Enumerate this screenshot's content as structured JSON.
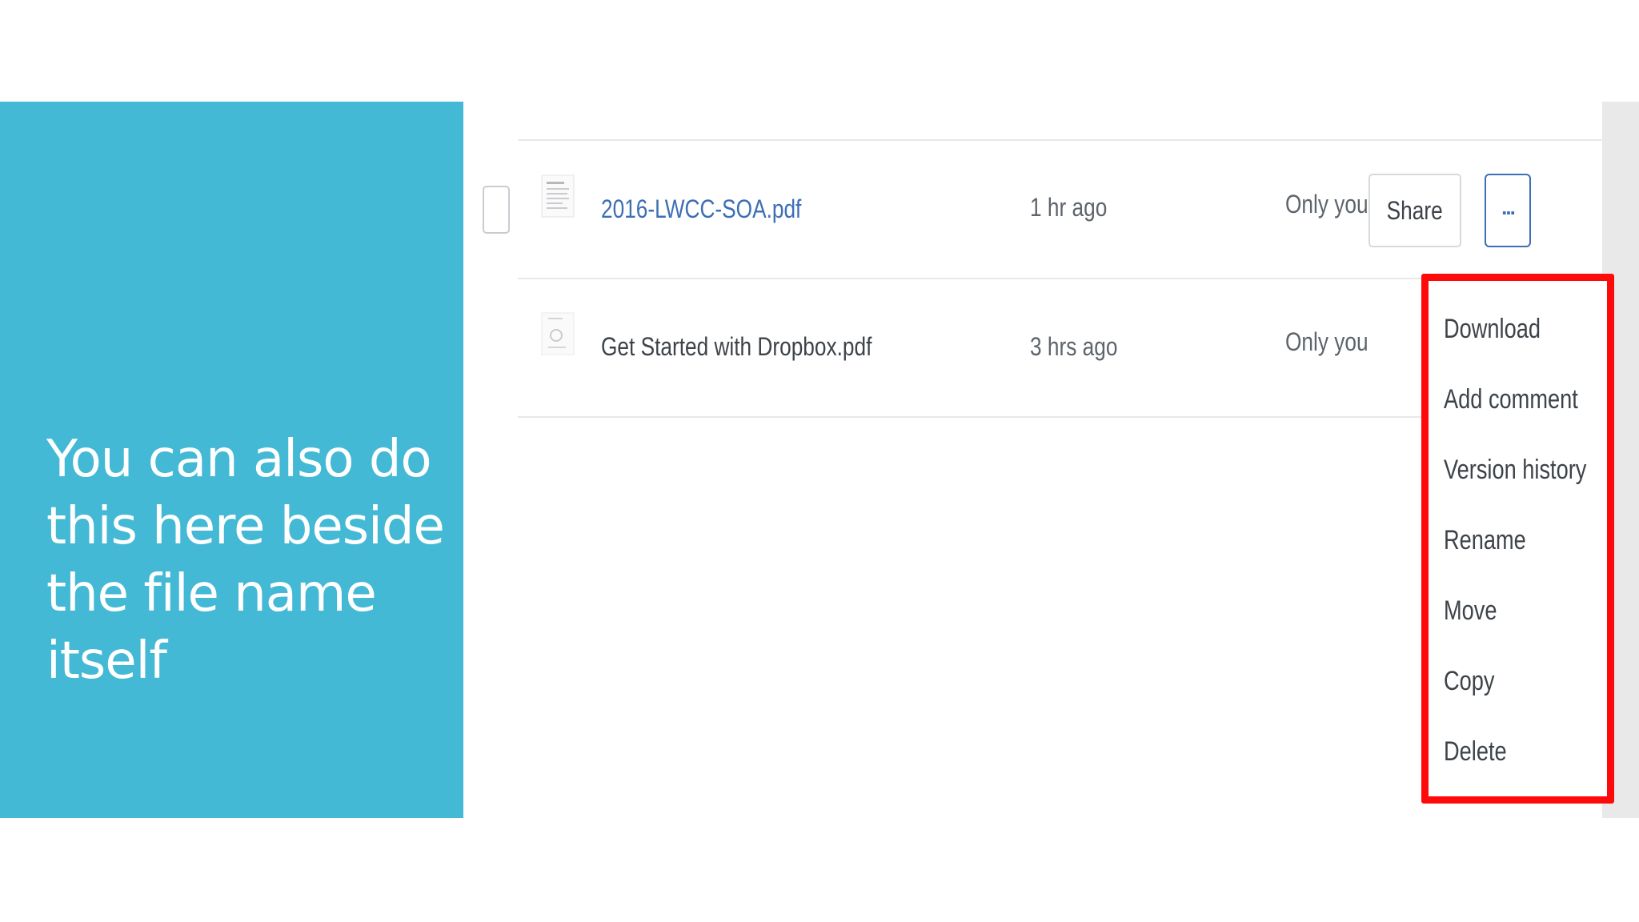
{
  "slide": {
    "text": "You can also do this here beside the file name itself"
  },
  "files": [
    {
      "name": "2016-LWCC-SOA.pdf",
      "modified": "1 hr ago",
      "members": "Only you",
      "selected_style": "link"
    },
    {
      "name": "Get Started with Dropbox.pdf",
      "modified": "3 hrs ago",
      "members": "Only you",
      "selected_style": "plain"
    }
  ],
  "actions": {
    "share_label": "Share",
    "more_label": "..."
  },
  "menu": {
    "items": [
      "Download",
      "Add comment",
      "Version history",
      "Rename",
      "Move",
      "Copy",
      "Delete"
    ]
  },
  "colors": {
    "panel": "#43b9d5",
    "link": "#3c6fb3",
    "highlight": "#ff0a0a"
  }
}
